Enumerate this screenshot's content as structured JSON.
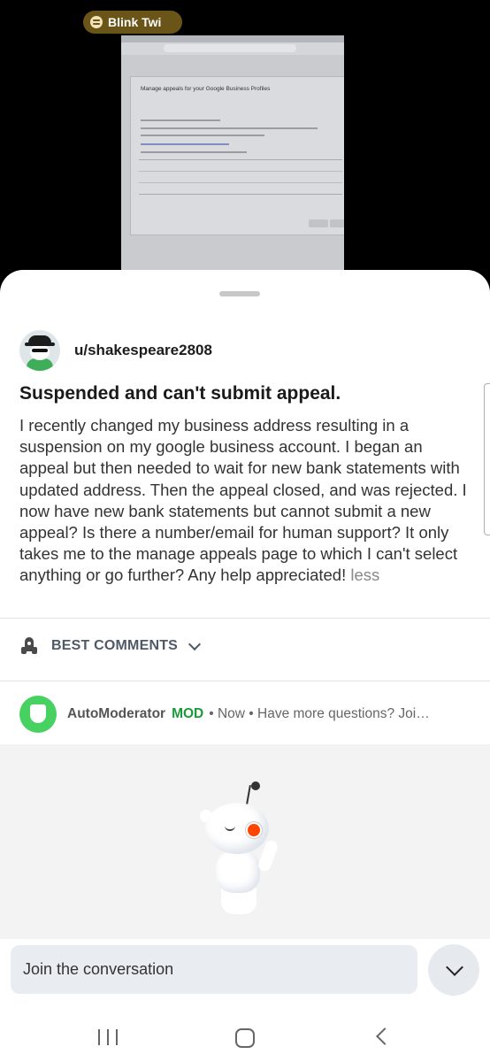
{
  "media_pill": {
    "app_icon": "spotify-icon",
    "text": "Blink Twi"
  },
  "screenshot_image": {
    "page_title": "Manage appeals for your Google Business Profiles"
  },
  "post": {
    "author": "u/shakespeare2808",
    "title": "Suspended and can't submit appeal.",
    "body": "I recently changed my business address resulting in a suspension on my google business account. I began an appeal but then needed to wait for new bank statements with updated address. Then the appeal closed, and was rejected. I now have new bank statements but cannot submit a new appeal? Is there a number/email for human support? It only takes me to the manage appeals page to which I can't select anything or go further? Any help appreciated!",
    "less_label": "less"
  },
  "sort": {
    "icon": "rocket-icon",
    "label": "BEST COMMENTS"
  },
  "comment": {
    "author": "AutoModerator",
    "badge": "MOD",
    "meta": "• Now • Have more questions? Join o..."
  },
  "composer": {
    "placeholder": "Join the conversation"
  },
  "colors": {
    "mod_green": "#1a9b3a",
    "automod_avatar": "#46d160",
    "snoo_eye": "#ff4500",
    "pill_bg": "#6b5417"
  }
}
